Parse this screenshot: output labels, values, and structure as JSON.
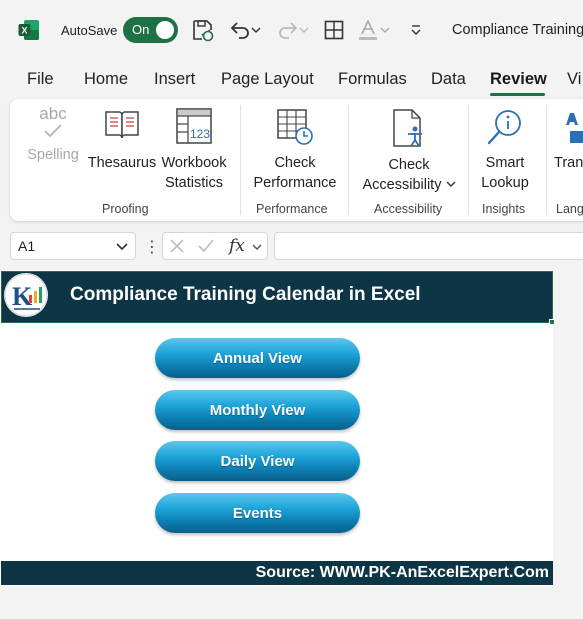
{
  "titlebar": {
    "autosave_label": "AutoSave",
    "autosave_state": "On",
    "doc_title": "Compliance Training",
    "accent": "#1e7145"
  },
  "tabs": [
    {
      "label": "File"
    },
    {
      "label": "Home"
    },
    {
      "label": "Insert"
    },
    {
      "label": "Page Layout"
    },
    {
      "label": "Formulas"
    },
    {
      "label": "Data"
    },
    {
      "label": "Review",
      "active": true
    },
    {
      "label": "Vi"
    }
  ],
  "ribbon": {
    "spelling": {
      "icon_text": "abc",
      "label": "Spelling"
    },
    "thesaurus": "Thesaurus",
    "workbook_statistics": {
      "line1": "Workbook",
      "line2": "Statistics",
      "icon_text": "123"
    },
    "check_performance": {
      "line1": "Check",
      "line2": "Performance"
    },
    "check_accessibility": {
      "line1": "Check",
      "line2": "Accessibility"
    },
    "smart_lookup": {
      "line1": "Smart",
      "line2": "Lookup"
    },
    "translate": "Tran",
    "groups": {
      "proofing": "Proofing",
      "performance": "Performance",
      "accessibility": "Accessibility",
      "insights": "Insights",
      "language": "Lang"
    }
  },
  "formula_bar": {
    "name_box": "A1",
    "fx": "fx",
    "formula": ""
  },
  "sheet": {
    "title": "Compliance Training Calendar in Excel",
    "buttons": [
      "Annual View",
      "Monthly View",
      "Daily View",
      "Events"
    ],
    "footer": "Source: WWW.PK-AnExcelExpert.Com",
    "band_color": "#0e3545",
    "button_color": "#1ea4d8"
  }
}
